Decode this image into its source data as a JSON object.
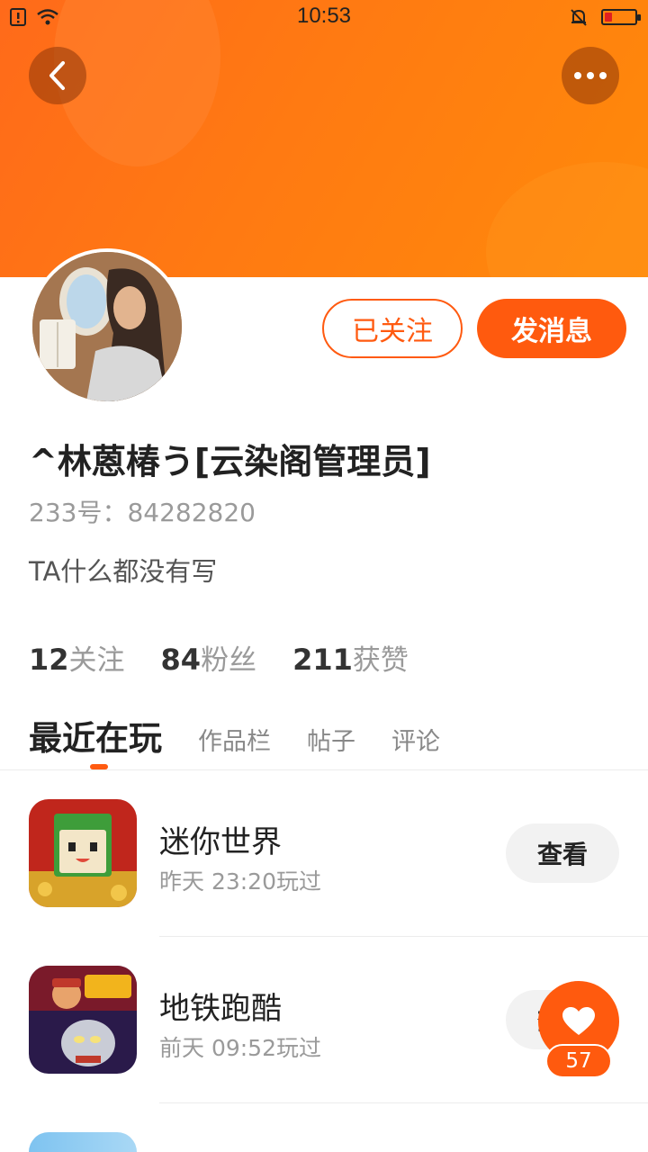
{
  "status_bar": {
    "time": "10:53"
  },
  "header": {
    "back_icon": "chevron-left-icon",
    "more_icon": "more-dots-icon"
  },
  "profile": {
    "followed_label": "已关注",
    "message_label": "发消息",
    "name": "^林蒽椿う[云染阁管理员]",
    "id_text": "233号：84282820",
    "bio": "TA什么都没有写"
  },
  "stats": [
    {
      "value": "12",
      "label": "关注"
    },
    {
      "value": "84",
      "label": "粉丝"
    },
    {
      "value": "211",
      "label": "获赞"
    }
  ],
  "tabs": [
    "最近在玩",
    "作品栏",
    "帖子",
    "评论"
  ],
  "games": [
    {
      "name": "迷你世界",
      "played": "昨天 23:20玩过",
      "action": "查看"
    },
    {
      "name": "地铁跑酷",
      "played": "前天 09:52玩过",
      "action": "查看"
    }
  ],
  "like": {
    "count": "57",
    "icon": "heart-icon"
  },
  "colors": {
    "accent": "#ff5a0e",
    "banner": "#ff7a12"
  }
}
